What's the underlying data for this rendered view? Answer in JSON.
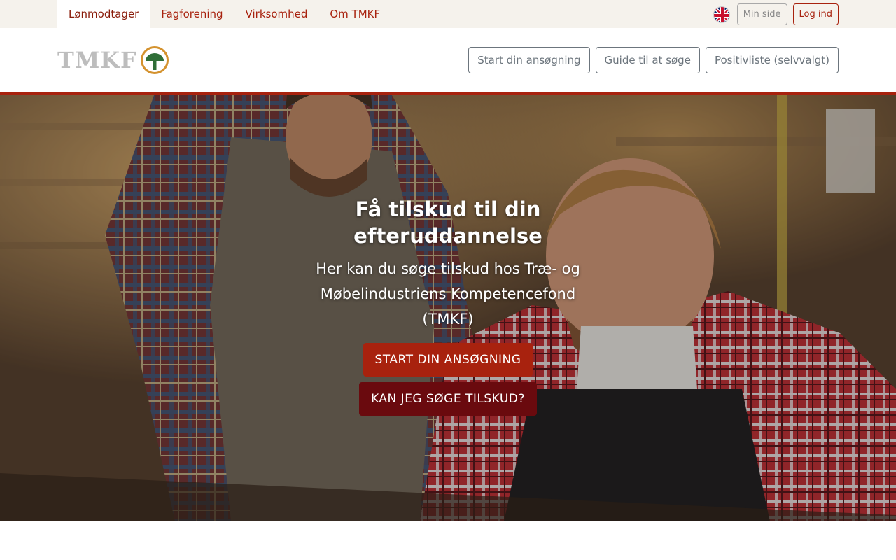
{
  "topnav": {
    "tabs": [
      "Lønmodtager",
      "Fagforening",
      "Virksomhed",
      "Om TMKF"
    ],
    "min_side": "Min side",
    "log_ind": "Log ind"
  },
  "header": {
    "logo_text": "TMKF",
    "nav": [
      "Start din ansøgning",
      "Guide til at søge",
      "Positivliste (selvvalgt)"
    ]
  },
  "hero": {
    "title": "Få tilskud til din efteruddannelse",
    "subtitle": "Her kan du søge tilskud hos Træ- og Møbelindustriens Kompetencefond (TMKF)",
    "btn_start": "START DIN ANSØGNING",
    "btn_kan": "KAN JEG SØGE TILSKUD?"
  },
  "below": {
    "left_heading": "",
    "right_heading": ""
  },
  "colors": {
    "brand_red": "#a8220e",
    "dark_red": "#6a0a0e",
    "top_bar_bg": "#f5f2ec"
  }
}
